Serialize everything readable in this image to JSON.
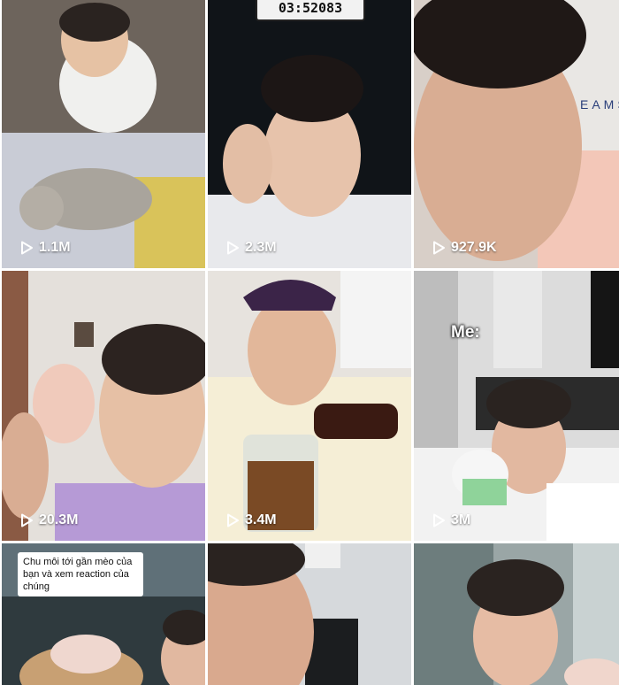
{
  "grid": {
    "videos": [
      {
        "views": "1.1M"
      },
      {
        "views": "2.3M",
        "overlay": "03:52083"
      },
      {
        "views": "927.9K",
        "overlay": "EAMS"
      },
      {
        "views": "20.3M"
      },
      {
        "views": "3.4M"
      },
      {
        "views": "3M",
        "overlay": "Me:"
      },
      {
        "caption": "Chu môi tới gần mèo của bạn và xem reaction của chúng"
      },
      {},
      {}
    ]
  },
  "icons": {
    "play": "play-outline-icon"
  },
  "colors": {
    "view_text": "#ffffff",
    "background": "#ffffff"
  }
}
